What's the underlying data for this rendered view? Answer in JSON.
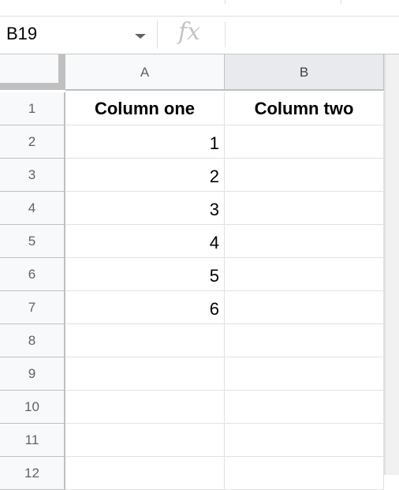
{
  "formula_bar": {
    "name_box": "B19",
    "fx_label": "fx",
    "formula_value": ""
  },
  "columns": [
    {
      "label": "A",
      "selected": false
    },
    {
      "label": "B",
      "selected": true
    }
  ],
  "rows": [
    {
      "num": "1",
      "cells": [
        "Column one",
        "Column two"
      ]
    },
    {
      "num": "2",
      "cells": [
        "1",
        ""
      ]
    },
    {
      "num": "3",
      "cells": [
        "2",
        ""
      ]
    },
    {
      "num": "4",
      "cells": [
        "3",
        ""
      ]
    },
    {
      "num": "5",
      "cells": [
        "4",
        ""
      ]
    },
    {
      "num": "6",
      "cells": [
        "5",
        ""
      ]
    },
    {
      "num": "7",
      "cells": [
        "6",
        ""
      ]
    },
    {
      "num": "8",
      "cells": [
        "",
        ""
      ]
    },
    {
      "num": "9",
      "cells": [
        "",
        ""
      ]
    },
    {
      "num": "10",
      "cells": [
        "",
        ""
      ]
    },
    {
      "num": "11",
      "cells": [
        "",
        ""
      ]
    },
    {
      "num": "12",
      "cells": [
        "",
        ""
      ]
    }
  ]
}
